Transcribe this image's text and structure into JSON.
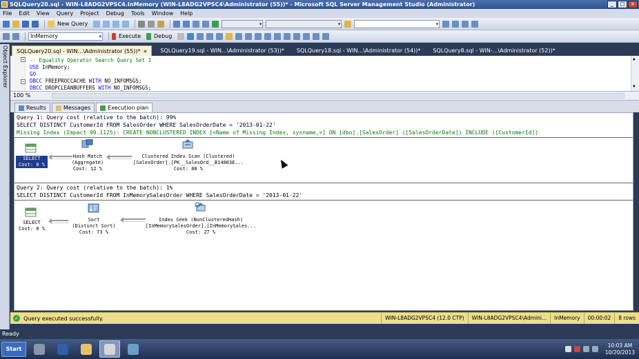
{
  "window": {
    "title": "SQLQuery20.sql - WIN-L8ADG2VPSC4.InMemory (WIN-L8ADG2VPSC4\\Administrator (55))* - Microsoft SQL Server Management Studio (Administrator)",
    "controls": [
      "_",
      "□",
      "✕"
    ]
  },
  "menu": [
    "File",
    "Edit",
    "View",
    "Query",
    "Project",
    "Debug",
    "Tools",
    "Window",
    "Help"
  ],
  "toolbar1": {
    "new_query_label": "New Query"
  },
  "toolbar2": {
    "database_selected": "InMemory",
    "execute_label": "Execute",
    "debug_label": "Debug"
  },
  "object_explorer_label": "Object Explorer",
  "tabs": [
    {
      "label": "SQLQuery20.sql - WIN...\\Administrator (55))*",
      "active": true
    },
    {
      "label": "SQLQuery19.sql - WIN...\\Administrator (53))*",
      "active": false
    },
    {
      "label": "SQLQuery18.sql - WIN...\\Administrator (54))*",
      "active": false
    },
    {
      "label": "SQLQuery8.sql - WIN-...\\Administrator (52))*",
      "active": false
    }
  ],
  "editor": {
    "lines": [
      {
        "comment": "-- Equality Operator Search Query Set 1"
      },
      {
        "kw": "USE",
        "rest": " InMemory;"
      },
      {
        "kw": "GO",
        "rest": ""
      },
      {
        "kw": "DBCC",
        "rest": " FREEPROCCACHE ",
        "kw2": "WITH",
        "rest2": " NO_INFOMSGS;"
      },
      {
        "kw": "DBCC",
        "rest": " DROPCLEANBUFFERS ",
        "kw2": "WITH",
        "rest2": " NO_INFOMSGS;"
      }
    ]
  },
  "zoom": "100 %",
  "result_tabs": [
    "Results",
    "Messages",
    "Execution plan"
  ],
  "plan": {
    "query1": {
      "header": "Query 1: Query cost (relative to the batch): 99%",
      "sql": "SELECT DISTINCT CustomerId FROM SalesOrder WHERE SalesOrderDate = '2013-01-22'",
      "missing_index": "Missing Index (Impact 99.1125): CREATE NONCLUSTERED INDEX [<Name of Missing Index, sysname,>] ON [dbo].[SalesOrder] ([SalesOrderDate]) INCLUDE ([CustomerId])",
      "nodes": [
        {
          "line1": "SELECT",
          "line2": "Cost: 0 %"
        },
        {
          "line1": "Hash Match",
          "line2": "(Aggregate)",
          "line3": "Cost: 12 %"
        },
        {
          "line1": "Clustered Index Scan (Clustered)",
          "line2": "[SalesOrder].[PK__SalesOrd__B14003E...",
          "line3": "Cost: 88 %"
        }
      ]
    },
    "query2": {
      "header": "Query 2: Query cost (relative to the batch): 1%",
      "sql": "SELECT DISTINCT CustomerId FROM InMemorySalesOrder WHERE SalesOrderDate = '2013-01-22'",
      "nodes": [
        {
          "line1": "SELECT",
          "line2": "Cost: 0 %"
        },
        {
          "line1": "Sort",
          "line2": "(Distinct Sort)",
          "line3": "Cost: 73 %"
        },
        {
          "line1": "Index Seek (NonClusteredHash)",
          "line2": "[InMemorySalesOrder].[InMemorySales...",
          "line3": "Cost: 27 %"
        }
      ]
    }
  },
  "status": {
    "message": "Query executed successfully.",
    "server": "WIN-L8ADG2VPSC4 (12.0 CTP)",
    "user": "WIN-L8ADG2VPSC4\\Admini...",
    "database": "InMemory",
    "elapsed": "00:00:02",
    "rows": "8 rows"
  },
  "ready": "Ready",
  "taskbar": {
    "start_label": "Start",
    "time": "10:03 AM",
    "date": "10/20/2013"
  },
  "colors": {
    "title_bg": "#2f5391",
    "status_bg": "#ecde8b",
    "keyword": "#0000ff",
    "comment": "#008000",
    "selected_node": "#1f3c8a"
  }
}
